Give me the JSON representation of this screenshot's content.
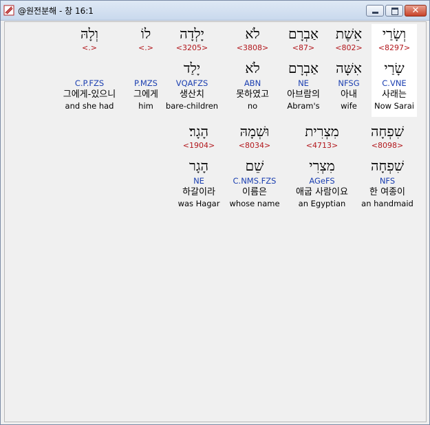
{
  "window": {
    "title": "@원전분해 - 창 16:1",
    "close_symbol": "✕"
  },
  "rows": [
    {
      "words": [
        {
          "heb": "וְשָׂרַי",
          "strong": "<8297>",
          "heb2": "שָׂרַי",
          "parse": "C.VNE",
          "kor": "사래는",
          "eng": "Now Sarai",
          "highlight": true
        },
        {
          "heb": "אֵשֶׁת",
          "strong": "<802>",
          "heb2": "אִשָּׁה",
          "parse": "NFSG",
          "kor": "아내",
          "eng": "wife",
          "highlight": false
        },
        {
          "heb": "אַבְרָם",
          "strong": "<87>",
          "heb2": "אַבְרָם",
          "parse": "NE",
          "kor": "아브람의",
          "eng": "Abram's",
          "highlight": false
        },
        {
          "heb": "לֹא",
          "strong": "<3808>",
          "heb2": "לֹא",
          "parse": "ABN",
          "kor": "못하였고",
          "eng": "no",
          "highlight": false
        },
        {
          "heb": "יָלְדָה",
          "strong": "<3205>",
          "heb2": "יָלַד",
          "parse": "VQAFZS",
          "kor": "생산치",
          "eng": "bare-children",
          "highlight": false
        },
        {
          "heb": "לוֹ",
          "strong": "<.>",
          "heb2": "",
          "parse": "P.MZS",
          "kor": "그에게",
          "eng": "him",
          "highlight": false
        },
        {
          "heb": "וְלָהּ",
          "strong": "<.>",
          "heb2": "",
          "parse": "C.P.FZS",
          "kor": "그에게-있으니",
          "eng": "and she had",
          "highlight": false
        }
      ]
    },
    {
      "words": [
        {
          "heb": "שִׁפְחָה",
          "strong": "<8098>",
          "heb2": "שִׁפְחָה",
          "parse": "NFS",
          "kor": "한 여종이",
          "eng": "an handmaid",
          "highlight": false
        },
        {
          "heb": "מִצְרִית",
          "strong": "<4713>",
          "heb2": "מִצְרִי",
          "parse": "AGeFS",
          "kor": "애굽 사람이요",
          "eng": "an Egyptian",
          "highlight": false
        },
        {
          "heb": "וּשְׁמָהּ",
          "strong": "<8034>",
          "heb2": "שֵׁם",
          "parse": "C.NMS.FZS",
          "kor": "이름은",
          "eng": "whose name",
          "highlight": false
        },
        {
          "heb": "הָגָר׃",
          "strong": "<1904>",
          "heb2": "הָגָר",
          "parse": "NE",
          "kor": "하갈이라",
          "eng": "was Hagar",
          "highlight": false
        }
      ]
    }
  ]
}
